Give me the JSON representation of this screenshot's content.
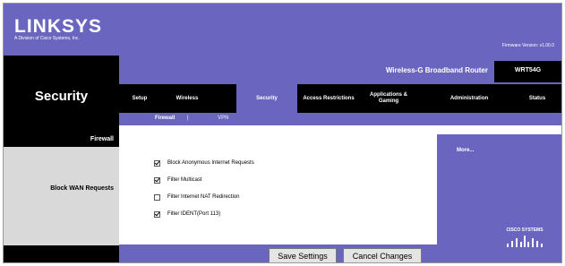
{
  "brand": {
    "logo": "LINKSYS",
    "logo_sub": "A Division of Cisco Systems, Inc.",
    "firmware": "Firmware Version: v1.00.0"
  },
  "header": {
    "section_title": "Security",
    "router_name": "Wireless-G Broadband Router",
    "model": "WRT54G"
  },
  "tabs": [
    {
      "label": "Setup"
    },
    {
      "label": "Wireless"
    },
    {
      "label": "Security"
    },
    {
      "label": "Access Restrictions"
    },
    {
      "label": "Applications & Gaming"
    },
    {
      "label": "Administration"
    },
    {
      "label": "Status"
    }
  ],
  "subtabs": [
    {
      "label": "Firewall"
    },
    {
      "label": "VPN"
    }
  ],
  "left": {
    "firewall": "Firewall",
    "block_wan": "Block WAN Requests"
  },
  "options": [
    {
      "label": "Block Anonymous Internet Requests",
      "checked": true
    },
    {
      "label": "Filter Multicast",
      "checked": true
    },
    {
      "label": "Filter Internet NAT Redirection",
      "checked": false
    },
    {
      "label": "Filter IDENT(Port 113)",
      "checked": true
    }
  ],
  "help": {
    "more": "More..."
  },
  "cisco": "CISCO SYSTEMS",
  "buttons": {
    "save": "Save Settings",
    "cancel": "Cancel Changes"
  },
  "colors": {
    "accent": "#6a66c0",
    "dark": "#000000"
  }
}
